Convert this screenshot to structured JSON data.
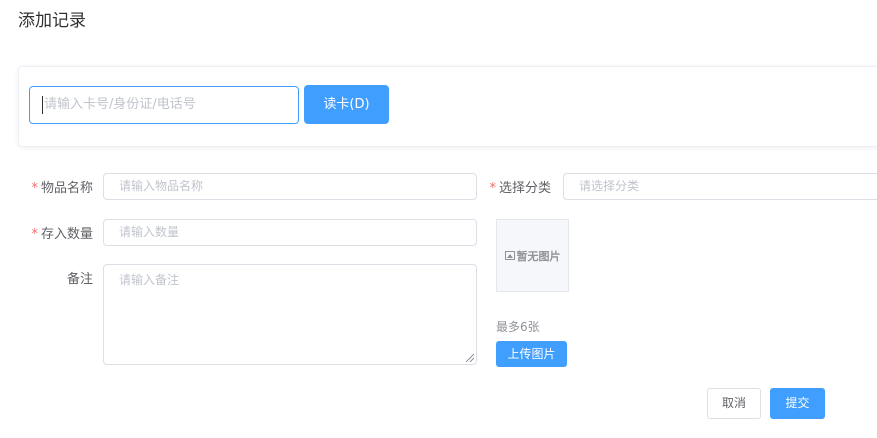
{
  "page": {
    "title": "添加记录"
  },
  "card_reader": {
    "input_placeholder": "请输入卡号/身份证/电话号",
    "read_button": "读卡(D)"
  },
  "form": {
    "item_name": {
      "label": "物品名称",
      "placeholder": "请输入物品名称",
      "required": "*"
    },
    "category": {
      "label": "选择分类",
      "placeholder": "请选择分类",
      "required": "*"
    },
    "quantity": {
      "label": "存入数量",
      "placeholder": "请输入数量",
      "required": "*"
    },
    "remark": {
      "label": "备注",
      "placeholder": "请输入备注"
    }
  },
  "images": {
    "empty_text": "暂无图片",
    "max_note": "最多6张",
    "upload_button": "上传图片"
  },
  "actions": {
    "cancel": "取消",
    "submit": "提交"
  },
  "colors": {
    "primary": "#409eff",
    "required": "#f56c6c",
    "border": "#dcdfe6",
    "placeholder": "#c0c4cc"
  }
}
